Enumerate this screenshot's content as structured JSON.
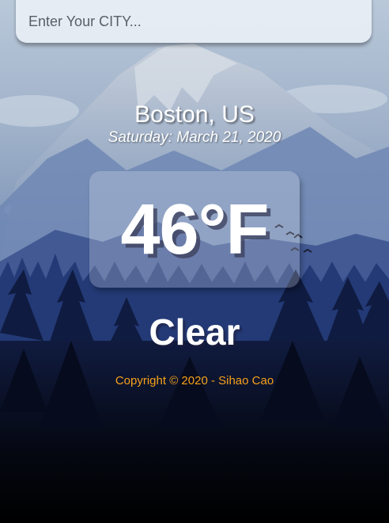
{
  "search": {
    "placeholder": "Enter Your CITY..."
  },
  "location": {
    "city": "Boston, US",
    "date": "Saturday: March 21, 2020"
  },
  "weather": {
    "temperature": "46°F",
    "condition": "Clear"
  },
  "footer": {
    "copyright": "Copyright © 2020 - Sihao Cao"
  },
  "colors": {
    "copyright_text": "#f6a11a",
    "sky": "#9fb3cc",
    "forest": "#0c1531"
  },
  "background": {
    "scene": "mountain-forest-illustration"
  }
}
